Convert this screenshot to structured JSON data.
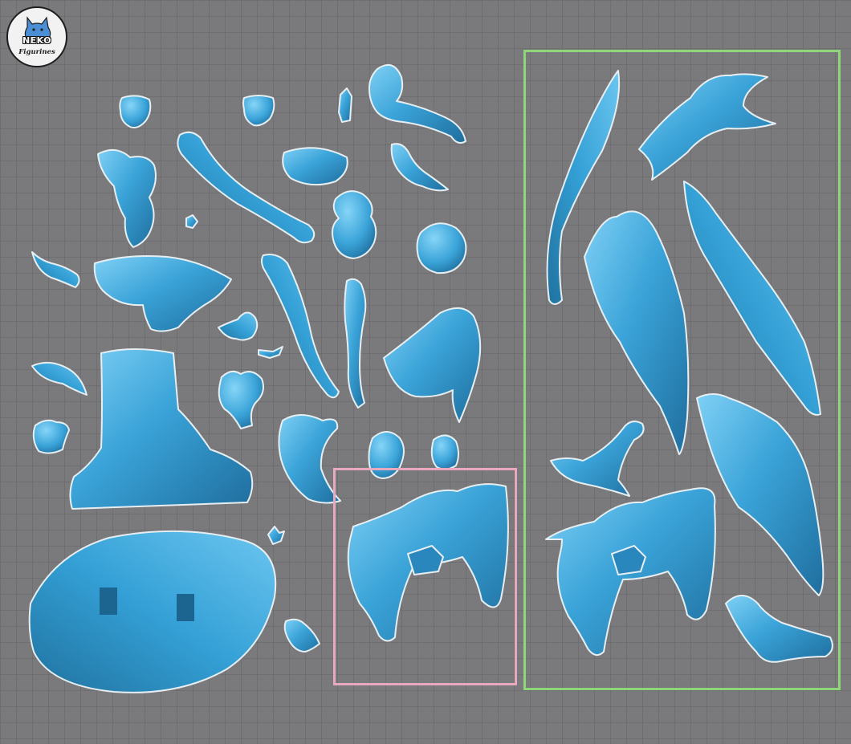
{
  "logo": {
    "brand": "NEKO",
    "subtitle": "Figurines",
    "icon": "cat-teacup-icon"
  },
  "colors": {
    "background": "#7a7a7d",
    "grid_line": "#6e6e72",
    "part_fill": "#3aa3d8",
    "part_highlight": "#7fd0f5",
    "part_shadow": "#1f6e9e",
    "part_outline": "#e8eef2",
    "selection_pink": "#e8a8be",
    "selection_green": "#8ed67a"
  },
  "parts": [
    "head-part",
    "head-part-alt",
    "small-pin-part",
    "cape-top-part",
    "torso-part",
    "leg-part",
    "hat-part",
    "small-figure-part",
    "cherub-part",
    "rose-part",
    "small-clip-part",
    "hair-strand-part",
    "rock-ledge-part",
    "arm-part",
    "leg-slim-part",
    "wing-fan-part",
    "tiny-figure-part",
    "tiny-bow-part",
    "leaf-part",
    "tree-stump-part",
    "bow-pendant-part",
    "wing-small-part",
    "hair-bun-part",
    "hair-bun-part-alt",
    "gem-part",
    "oval-base-part",
    "tiny-star-part",
    "small-bird-part",
    "skirt-part",
    "skirt-part-copy",
    "wing-feather-part",
    "wing-tip-part",
    "wing-large-part",
    "wing-long-part",
    "wing-cluster-part",
    "ribbon-part",
    "ribbon-part-copy"
  ],
  "selections": [
    "pink-selection-box",
    "green-selection-box"
  ]
}
